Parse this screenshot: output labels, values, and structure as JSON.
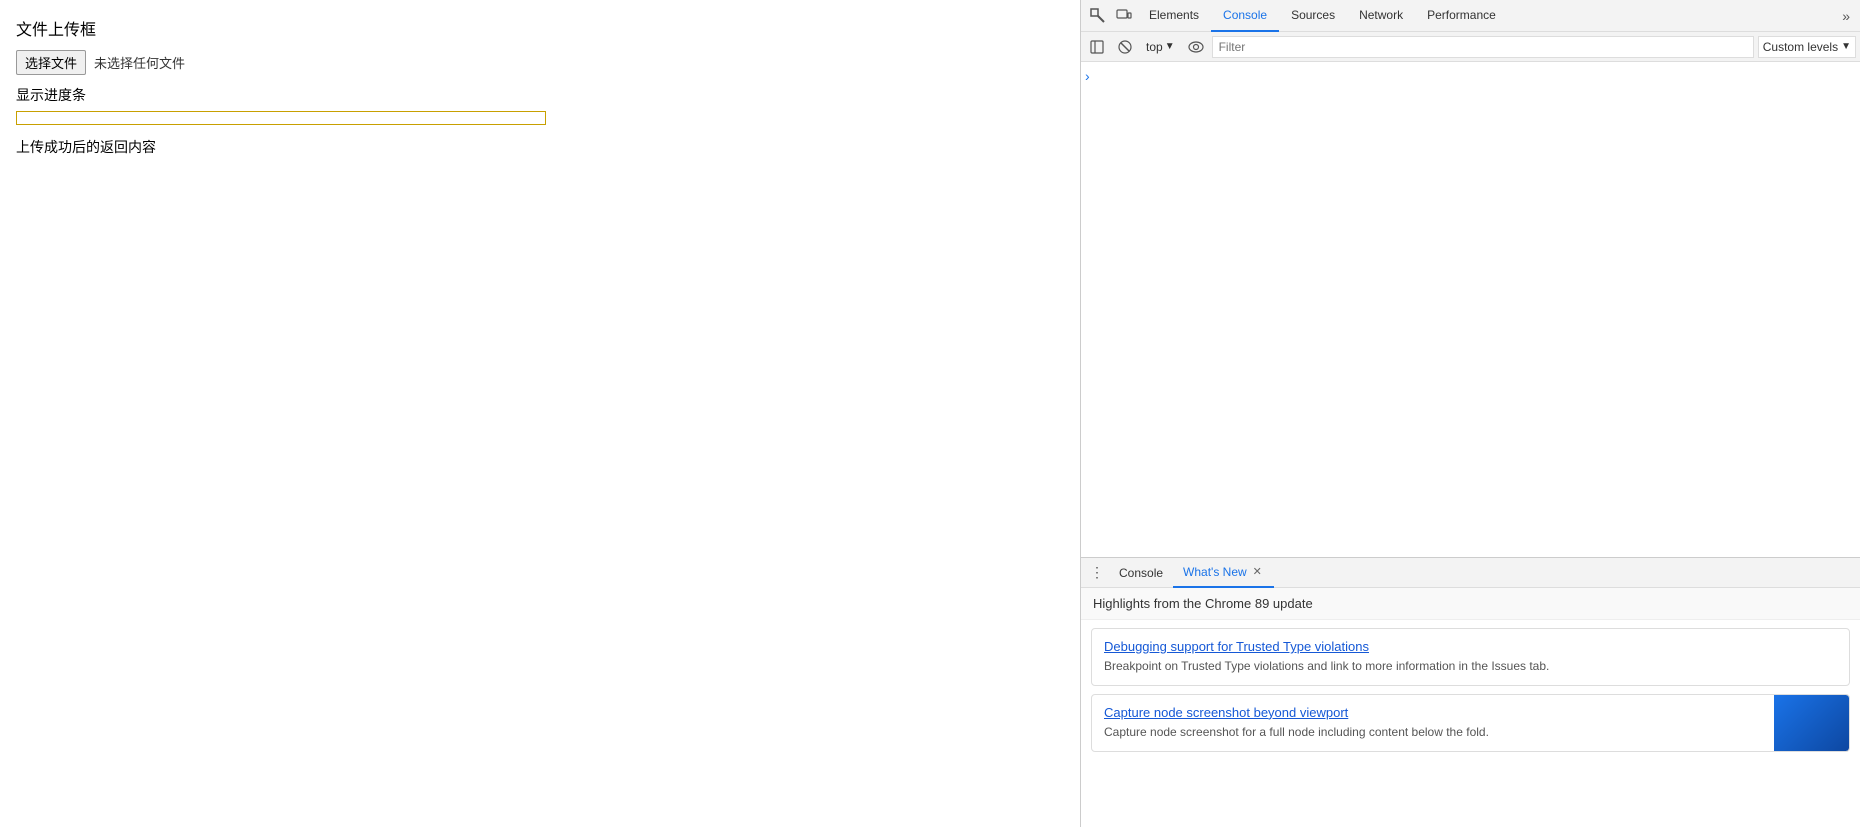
{
  "mainContent": {
    "title": "文件上传框",
    "chooseFileBtn": "选择文件",
    "noFileLabel": "未选择任何文件",
    "progressLabel": "显示进度条",
    "uploadResultLabel": "上传成功后的返回内容"
  },
  "devtools": {
    "tabs": [
      {
        "label": "Elements",
        "active": false
      },
      {
        "label": "Console",
        "active": true
      },
      {
        "label": "Sources",
        "active": false
      },
      {
        "label": "Network",
        "active": false
      },
      {
        "label": "Performance",
        "active": false
      }
    ],
    "moreBtn": "»",
    "contextSelector": "top",
    "filterPlaceholder": "Filter",
    "customLevelsBtn": "Custom levels",
    "consoleExpandArrow": "›"
  },
  "bottomPanel": {
    "tabs": [
      {
        "label": "Console",
        "active": false,
        "closable": false
      },
      {
        "label": "What's New",
        "active": true,
        "closable": true
      }
    ],
    "menuBtn": "⋮",
    "whatsNewHeader": "Highlights from the Chrome 89 update",
    "cards": [
      {
        "title": "Debugging support for Trusted Type violations",
        "description": "Breakpoint on Trusted Type violations and link to more information in the Issues tab.",
        "hasAccent": false
      },
      {
        "title": "Capture node screenshot beyond viewport",
        "description": "Capture node screenshot for a full node including content below the fold.",
        "hasAccent": true
      }
    ]
  },
  "icons": {
    "inspect": "⬚",
    "deviceToggle": "☐",
    "settings": "⚙",
    "stop": "⊘",
    "clear": "🚫",
    "chevronDown": "▼",
    "eye": "👁",
    "close": "✕"
  }
}
